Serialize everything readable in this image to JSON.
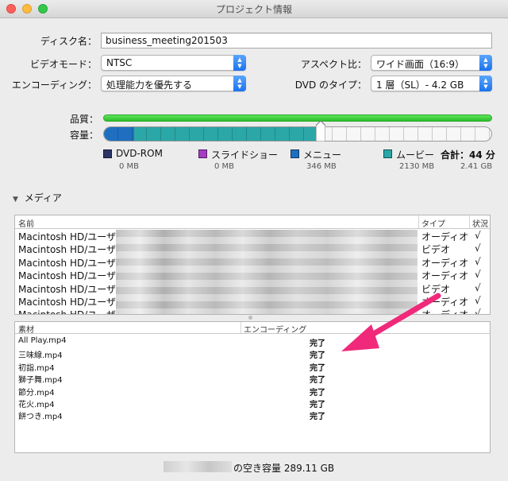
{
  "window": {
    "title": "プロジェクト情報"
  },
  "form": {
    "disk_name_label": "ディスク名：",
    "disk_name_value": "business_meeting201503",
    "video_mode_label": "ビデオモード：",
    "video_mode_value": "NTSC",
    "encoding_label": "エンコーディング：",
    "encoding_value": "処理能力を優先する",
    "aspect_label": "アスペクト比：",
    "aspect_value": "ワイド画面（16:9）",
    "dvd_type_label": "DVD のタイプ：",
    "dvd_type_value": "1 層（SL）- 4.2 GB"
  },
  "meters": {
    "quality_label": "品質：",
    "capacity_label": "容量：",
    "quality_level": 1.0,
    "capacity_used_fraction": 0.56,
    "colors": {
      "quality": "#34c43a",
      "menu": "#1f6fc0",
      "movie": "#2ba7a7"
    }
  },
  "legend": {
    "items": [
      {
        "label": "DVD-ROM",
        "size": "0 MB",
        "color": "#2c3566"
      },
      {
        "label": "スライドショー",
        "size": "0 MB",
        "color": "#a53cc4"
      },
      {
        "label": "メニュー",
        "size": "346 MB",
        "color": "#1f6fc0"
      },
      {
        "label": "ムービー",
        "size": "2130 MB",
        "color": "#2ba7a7"
      }
    ],
    "total_label": "合計：44 分",
    "total_size": "2.41 GB"
  },
  "media": {
    "section_label": "メディア",
    "columns": {
      "name": "名前",
      "type": "タイプ",
      "status": "状況"
    },
    "rows": [
      {
        "name": "Macintosh HD/ユーザ/",
        "type": "オーディオ",
        "status": "√"
      },
      {
        "name": "Macintosh HD/ユーザ/",
        "type": "ビデオ",
        "status": "√"
      },
      {
        "name": "Macintosh HD/ユーザ/",
        "type": "オーディオ",
        "status": "√"
      },
      {
        "name": "Macintosh HD/ユーザ/",
        "type": "オーディオ",
        "status": "√"
      },
      {
        "name": "Macintosh HD/ユーザ/",
        "type": "ビデオ",
        "status": "√"
      },
      {
        "name": "Macintosh HD/ユーザ/",
        "type": "オーディオ",
        "status": "√"
      },
      {
        "name": "Macintosh HD/ユーザ/",
        "type": "オーディオ",
        "status": "√"
      }
    ]
  },
  "assets": {
    "columns": {
      "material": "素材",
      "encoding": "エンコーディング"
    },
    "rows": [
      {
        "name": "All Play.mp4",
        "status": "完了"
      },
      {
        "name": "三味線.mp4",
        "status": "完了"
      },
      {
        "name": "初詣.mp4",
        "status": "完了"
      },
      {
        "name": "獅子舞.mp4",
        "status": "完了"
      },
      {
        "name": "節分.mp4",
        "status": "完了"
      },
      {
        "name": "花火.mp4",
        "status": "完了"
      },
      {
        "name": "餅つき.mp4",
        "status": "完了"
      }
    ]
  },
  "footer": {
    "free_space": "の空き容量 289.11 GB"
  }
}
